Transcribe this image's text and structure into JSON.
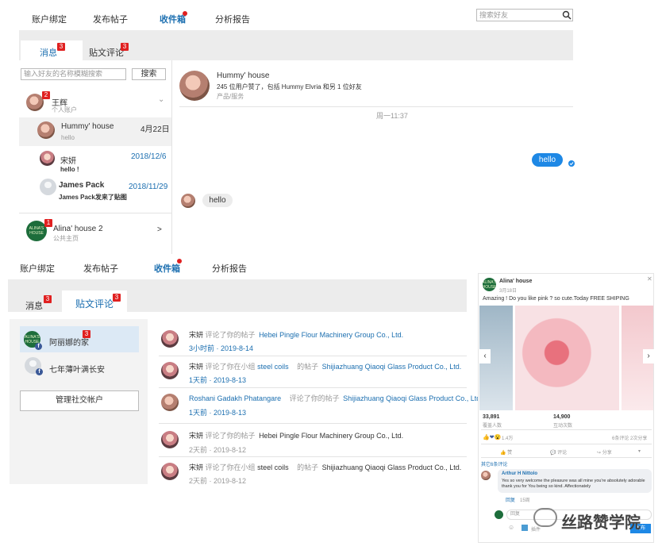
{
  "top": {
    "nav": [
      "账户绑定",
      "发布帖子",
      "收件箱",
      "分析报告"
    ],
    "search_placeholder": "搜索好友",
    "tabs": [
      {
        "label": "消息",
        "badge": "3"
      },
      {
        "label": "贴文评论",
        "badge": "3"
      }
    ],
    "friend_search_placeholder": "输入好友的名称模糊搜索",
    "search_button": "搜索",
    "accounts": [
      {
        "name": "王辉",
        "type": "个人账户",
        "badge": "2"
      },
      {
        "name": "Alina' house 2",
        "type": "公共主页",
        "badge": "1"
      }
    ],
    "conversations": [
      {
        "name": "Hummy' house",
        "date": "4月22日",
        "preview": "hello"
      },
      {
        "name": "宋妍",
        "date": "2018/12/6",
        "preview": "hello !"
      },
      {
        "name": "James Pack",
        "date": "2018/11/29",
        "preview": "James Pack发来了贴图"
      }
    ],
    "chat": {
      "name": "Hummy' house",
      "desc": "245 位用户赞了，包括 Hummy Elvria 和另 1 位好友",
      "category": "产品/服务",
      "time": "周一11:37",
      "sent": "hello",
      "received": "hello"
    },
    "chevron_down": "⌄",
    "arrow": ">",
    "logo_text": "ALINA'S HOUSE"
  },
  "bottom": {
    "nav": [
      "账户绑定",
      "发布帖子",
      "收件箱",
      "分析报告"
    ],
    "tabs": [
      {
        "label": "消息",
        "badge": "3"
      },
      {
        "label": "贴文评论",
        "badge": "3"
      }
    ],
    "accounts": [
      {
        "name": "阿丽娜的家",
        "badge": "3"
      },
      {
        "name": "七年薄叶满长安"
      }
    ],
    "manage_button": "管理社交帐户",
    "comments": [
      {
        "user": "宋妍",
        "action": "评论了你的帖子",
        "group": "",
        "mid": "",
        "company": "Hebei Pingle Flour Machinery Group Co., Ltd.",
        "time": "3小时前 · 2019-8-14",
        "active": true
      },
      {
        "user": "宋妍",
        "action": "评论了你在小组",
        "group": "steel coils",
        "mid": "的帖子",
        "company": "Shijiazhuang Qiaoqi Glass Product Co., Ltd.",
        "time": "1天前 · 2019-8-13",
        "active": true
      },
      {
        "user": "Roshani Gadakh Phatangare",
        "action": "评论了你的帖子",
        "group": "",
        "mid": "",
        "company": "Shijiazhuang Qiaoqi Glass Product Co., Ltd",
        "time": "1天前 · 2019-8-13",
        "active": true
      },
      {
        "user": "宋妍",
        "action": "评论了你的帖子",
        "group": "",
        "mid": "",
        "company": "Hebei Pingle Flour Machinery Group Co., Ltd.",
        "time": "2天前 · 2019-8-12",
        "active": false
      },
      {
        "user": "宋妍",
        "action": "评论了你在小组",
        "group": "steel coils",
        "mid": "的帖子",
        "company": "Shijiazhuang Qiaoqi Glass Product Co., Ltd.",
        "time": "2天前 · 2019-8-12",
        "active": false
      }
    ]
  },
  "post": {
    "page": "Alina' house",
    "date": "3月18日",
    "text": "Amazing ! Do you like pink ? so cute.Today FREE SHIPING",
    "reach": "33,891",
    "reach_label": "覆盖人数",
    "engage": "14,900",
    "engage_label": "互动次数",
    "reactions": "1.4万",
    "counts": "6条评论  2次分享",
    "like": "赞",
    "comment": "评论",
    "share": "分享",
    "more": "其它6条评论",
    "commenter": "Arthur H Nittolo",
    "comment_text": "Yes so very welcome the pleasure was all mine you're absolutely adorable thank you for You being so kind. Affectionately",
    "reply": "回复",
    "reply_time": "15周",
    "reply_placeholder": "回复",
    "send": "发布",
    "watermark": "丝路赞学院",
    "bar_item": "插件"
  }
}
